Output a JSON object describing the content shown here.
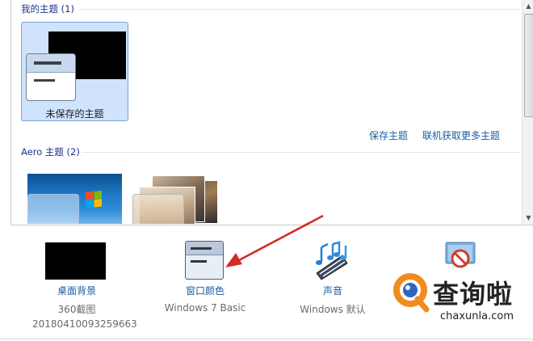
{
  "panel": {
    "my_themes_header": "我的主题 (1)",
    "unsaved_theme_label": "未保存的主题",
    "save_theme_link": "保存主题",
    "get_more_link": "联机获取更多主题",
    "aero_header": "Aero 主题 (2)"
  },
  "bottom": {
    "desktop_background": {
      "label": "桌面背景",
      "sub1": "360截图",
      "sub2": "20180410093259663"
    },
    "window_color": {
      "label": "窗口颜色",
      "sub": "Windows 7 Basic"
    },
    "sounds": {
      "label": "声音",
      "sub": "Windows 默认"
    },
    "screen_saver": {
      "label": ""
    }
  },
  "watermark": {
    "brand_cn": "查询啦",
    "brand_url": "chaxunla.com"
  },
  "colors": {
    "link": "#1a5ea6",
    "group_header": "#1e3287",
    "selected_tile": "#cfe3fc",
    "annotation_arrow": "#d42b24",
    "watermark_orange": "#f08c1e",
    "watermark_blue": "#2f64c3"
  },
  "icons": {
    "desktop_background": "black-thumbnail-icon",
    "window_color": "window-color-icon",
    "sounds": "music-notes-icon",
    "screen_saver": "screen-saver-disabled-icon",
    "watermark": "magnifier-q-logo"
  }
}
